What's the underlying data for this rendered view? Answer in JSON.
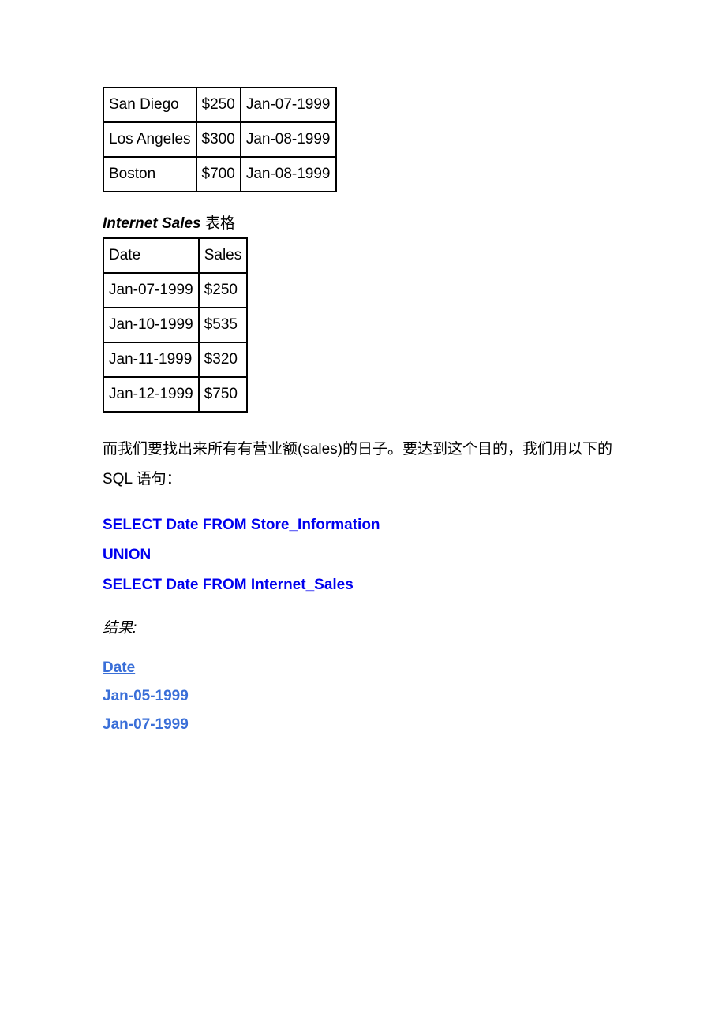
{
  "table1": {
    "rows": [
      {
        "c0": "San Diego",
        "c1": "$250",
        "c2": "Jan-07-1999"
      },
      {
        "c0": "Los Angeles",
        "c1": "$300",
        "c2": "Jan-08-1999"
      },
      {
        "c0": "Boston",
        "c1": "$700",
        "c2": "Jan-08-1999"
      }
    ]
  },
  "title2_italic": "Internet Sales",
  "title2_rest": " 表格",
  "table2": {
    "headers": {
      "h0": "Date",
      "h1": "Sales"
    },
    "rows": [
      {
        "c0": "Jan-07-1999",
        "c1": "$250"
      },
      {
        "c0": "Jan-10-1999",
        "c1": "$535"
      },
      {
        "c0": "Jan-11-1999",
        "c1": "$320"
      },
      {
        "c0": "Jan-12-1999",
        "c1": "$750"
      }
    ]
  },
  "paragraph": "而我们要找出来所有有营业额(sales)的日子。要达到这个目的，我们用以下的 SQL 语句：",
  "sql": {
    "line1": "SELECT Date FROM Store_Information",
    "line2": "UNION",
    "line3": "SELECT Date FROM Internet_Sales"
  },
  "result_label": "结果:",
  "result": {
    "header": "Date",
    "rows": [
      "Jan-05-1999",
      "Jan-07-1999"
    ]
  }
}
